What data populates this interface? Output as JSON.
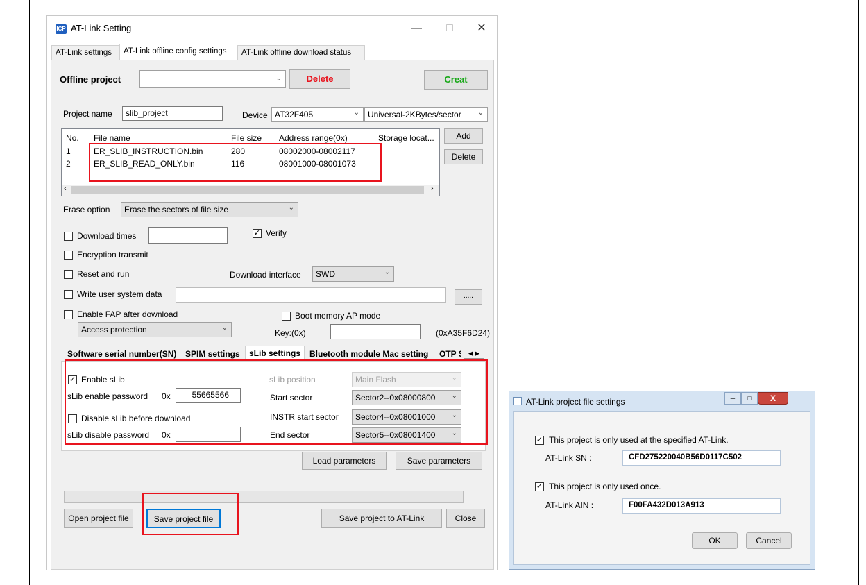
{
  "main_window": {
    "title": "AT-Link Setting",
    "app_icon_text": "ICP",
    "tabs": [
      "AT-Link settings",
      "AT-Link offline config settings",
      "AT-Link offline download status"
    ],
    "offline_project": {
      "label": "Offline project",
      "value": "",
      "delete_label": "Delete",
      "creat_label": "Creat",
      "delete_color": "#e8141e",
      "creat_color": "#18a818"
    },
    "project_name": {
      "label": "Project name",
      "value": "slib_project"
    },
    "device": {
      "label": "Device",
      "value": "AT32F405",
      "sector": "Universal-2KBytes/sector"
    },
    "file_table": {
      "columns": [
        "No.",
        "File name",
        "File size",
        "Address range(0x)",
        "Storage locat..."
      ],
      "rows": [
        [
          "1",
          "ER_SLIB_INSTRUCTION.bin",
          "280",
          "08002000-08002117",
          ""
        ],
        [
          "2",
          "ER_SLIB_READ_ONLY.bin",
          "116",
          "08001000-08001073",
          ""
        ]
      ],
      "add_label": "Add",
      "delete_label": "Delete"
    },
    "erase_option": {
      "label": "Erase option",
      "value": "Erase the sectors of file size"
    },
    "download_times": {
      "label": "Download times",
      "checked": false,
      "value": ""
    },
    "verify": {
      "label": "Verify",
      "checked": true
    },
    "encryption_transmit": {
      "label": "Encryption transmit",
      "checked": false
    },
    "reset_and_run": {
      "label": "Reset and run",
      "checked": false
    },
    "download_interface": {
      "label": "Download interface",
      "value": "SWD"
    },
    "write_user_system_data": {
      "label": "Write user system data",
      "checked": false,
      "value": "",
      "browse_label": "....."
    },
    "enable_fap": {
      "label": "Enable FAP after download",
      "checked": false,
      "value": "Access protection"
    },
    "boot_memory_ap": {
      "label": "Boot memory AP mode",
      "checked": false
    },
    "key": {
      "label": "Key:(0x)",
      "value": "",
      "hint": "(0xA35F6D24)"
    },
    "sub_tabs": [
      "Software serial number(SN)",
      "SPIM settings",
      "sLib settings",
      "Bluetooth module Mac setting",
      "OTP S"
    ],
    "slib": {
      "enable_label": "Enable sLib",
      "enable_checked": true,
      "enable_password_label": "sLib enable password",
      "prefix": "0x",
      "enable_password_value": "55665566",
      "disable_before_label": "Disable sLib before download",
      "disable_before_checked": false,
      "disable_password_label": "sLib disable password",
      "disable_password_value": "",
      "position_label": "sLib position",
      "position_value": "Main Flash",
      "start_sector_label": "Start sector",
      "start_sector_value": "Sector2--0x08000800",
      "instr_start_label": "INSTR start sector",
      "instr_start_value": "Sector4--0x08001000",
      "end_sector_label": "End sector",
      "end_sector_value": "Sector5--0x08001400"
    },
    "load_parameters_label": "Load parameters",
    "save_parameters_label": "Save parameters",
    "open_project_label": "Open project file",
    "save_project_label": "Save project file",
    "save_to_atlink_label": "Save project to AT-Link",
    "close_label": "Close"
  },
  "dialog": {
    "title": "AT-Link project file settings",
    "specified_label": "This project is only used at the specified AT-Link.",
    "specified_checked": true,
    "sn_label": "AT-Link SN :",
    "sn_value": "CFD275220040B56D0117C502",
    "once_label": "This project is only used once.",
    "once_checked": true,
    "ain_label": "AT-Link AIN :",
    "ain_value": "F00FA432D013A913",
    "ok_label": "OK",
    "cancel_label": "Cancel",
    "close_glyph": "X"
  },
  "annotation_color": "#e8141e"
}
